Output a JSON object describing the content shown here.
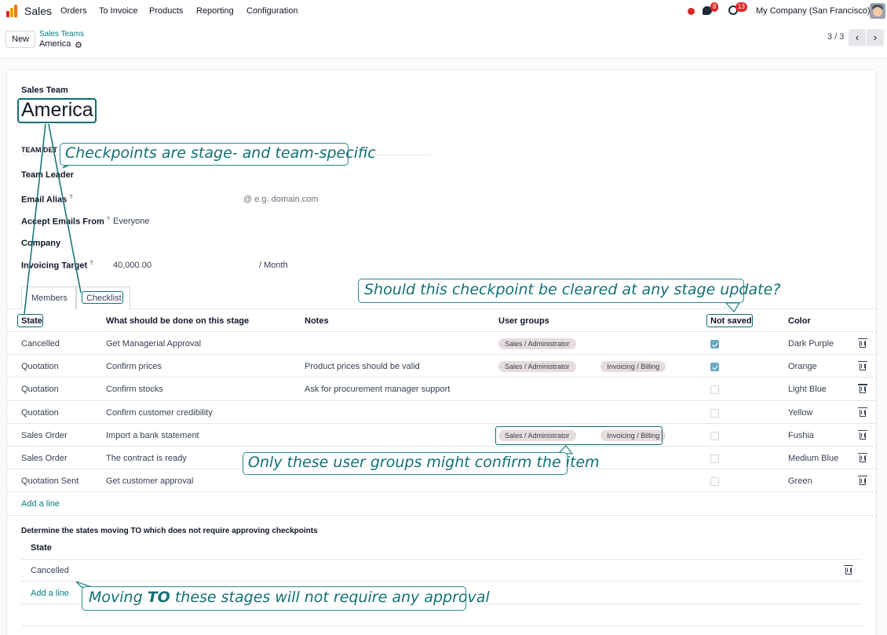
{
  "navbar": {
    "app_name": "Sales",
    "menu": [
      "Orders",
      "To Invoice",
      "Products",
      "Reporting",
      "Configuration"
    ],
    "messages_count": "8",
    "activities_count": "13",
    "company": "My Company (San Francisco)"
  },
  "control_panel": {
    "new_label": "New",
    "breadcrumb": "Sales Teams",
    "record": "America",
    "pager": "3 / 3"
  },
  "form": {
    "title_label": "Sales Team",
    "title": "America",
    "section_team_details": "TEAM DET",
    "team_leader_label": "Team Leader",
    "email_alias_label": "Email Alias",
    "email_domain_placeholder": "@ e.g. domain.com",
    "accept_emails_label": "Accept Emails From",
    "accept_emails_value": "Everyone",
    "company_label": "Company",
    "invoicing_target_label": "Invoicing Target",
    "invoicing_target_value": "40,000.00",
    "invoicing_target_unit": "/ Month",
    "help_marker": "?"
  },
  "tabs": [
    "Members",
    "Checklist"
  ],
  "checklist": {
    "columns": [
      "State",
      "What should be done on this stage",
      "Notes",
      "User groups",
      "Not saved",
      "Color"
    ],
    "rows": [
      {
        "state": "Cancelled",
        "task": "Get Managerial Approval",
        "notes": "",
        "groups": [
          "Sales / Administrator"
        ],
        "not_saved": true,
        "color": "Dark Purple"
      },
      {
        "state": "Quotation",
        "task": "Confirm prices",
        "notes": "Product prices should be valid",
        "groups": [
          "Sales / Administrator",
          "Invoicing / Billing"
        ],
        "not_saved": true,
        "color": "Orange"
      },
      {
        "state": "Quotation",
        "task": "Confirm stocks",
        "notes": "Ask for procurement manager support",
        "groups": [],
        "not_saved": false,
        "color": "Light Blue"
      },
      {
        "state": "Quotation",
        "task": "Confirm customer credibility",
        "notes": "",
        "groups": [],
        "not_saved": false,
        "color": "Yellow"
      },
      {
        "state": "Sales Order",
        "task": "Import a bank statement",
        "notes": "",
        "groups": [
          "Sales / Administrator",
          "Invoicing / Billing"
        ],
        "not_saved": false,
        "color": "Fushia"
      },
      {
        "state": "Sales Order",
        "task": "The contract is ready",
        "notes": "",
        "groups": [],
        "not_saved": false,
        "color": "Medium Blue"
      },
      {
        "state": "Quotation Sent",
        "task": "Get customer approval",
        "notes": "",
        "groups": [],
        "not_saved": false,
        "color": "Green"
      }
    ],
    "add_line": "Add a line"
  },
  "no_approval": {
    "heading": "Determine the states moving TO which does not require approving checkpoints",
    "column": "State",
    "rows": [
      "Cancelled"
    ],
    "add_line": "Add a line"
  },
  "callouts": {
    "checkpoints": "Checkpoints are stage- and team-specific",
    "cleared": "Should this checkpoint be cleared at any stage update?",
    "groups": "Only these user groups might confirm the item",
    "moving_pre": "Moving ",
    "moving_bold": "TO",
    "moving_post": " these stages will not require any approval"
  },
  "colors": {
    "accent": "#017e84",
    "annotation": "#0e6e73",
    "badge": "#dc2626"
  }
}
